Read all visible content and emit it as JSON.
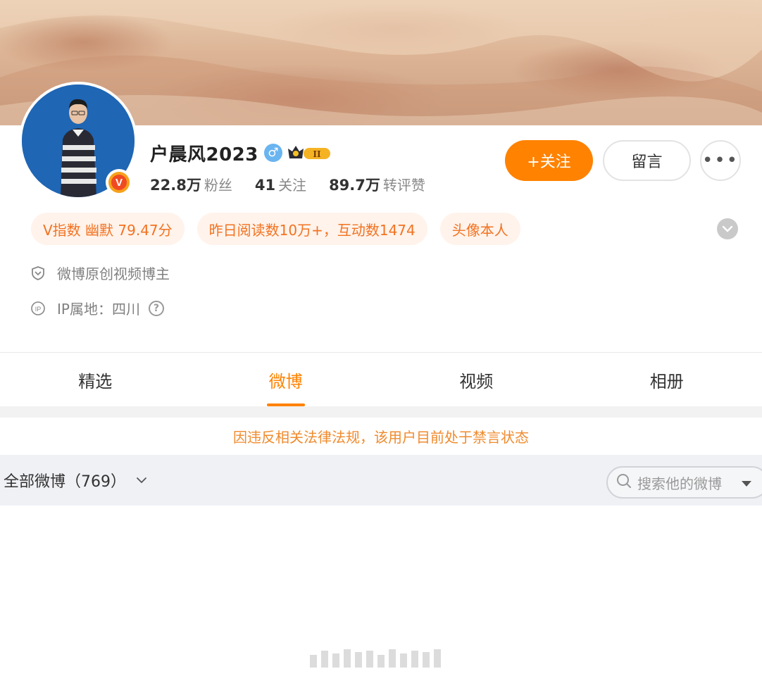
{
  "profile": {
    "name": "户晨风2023",
    "gender_icon": "male-icon",
    "stats": [
      {
        "value": "22.8万",
        "label": "粉丝"
      },
      {
        "value": "41",
        "label": "关注"
      },
      {
        "value": "89.7万",
        "label": "转评赞"
      }
    ]
  },
  "actions": {
    "follow": "+关注",
    "message": "留言",
    "more": "•••"
  },
  "tags": [
    "V指数 幽默 79.47分",
    "昨日阅读数10万+，互动数1474",
    "头像本人"
  ],
  "info": {
    "creator": "微博原创视频博主",
    "ip_location": "IP属地：四川",
    "ip_icon_text": "IP"
  },
  "tabs": [
    {
      "label": "精选",
      "active": false
    },
    {
      "label": "微博",
      "active": true
    },
    {
      "label": "视频",
      "active": false
    },
    {
      "label": "相册",
      "active": false
    }
  ],
  "notice": "因违反相关法律法规，该用户目前处于禁言状态",
  "filter": {
    "label": "全部微博（769）",
    "search_placeholder": "搜索他的微博"
  },
  "colors": {
    "accent": "#ff8200",
    "tag_text": "#f27221",
    "tag_bg": "#fff3eb"
  }
}
